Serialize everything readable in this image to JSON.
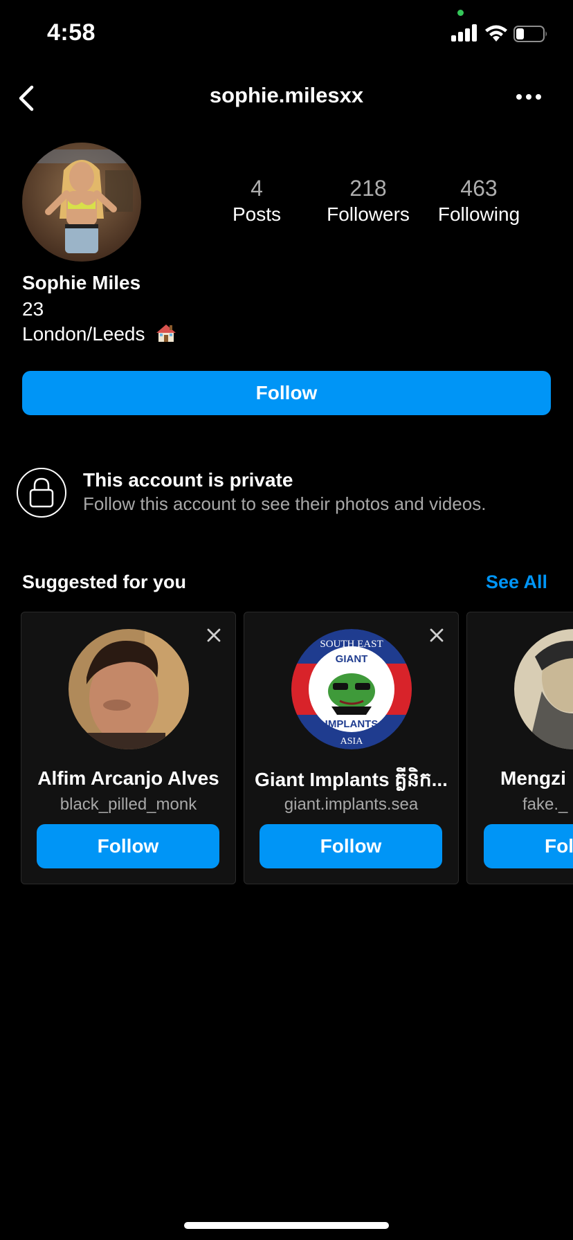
{
  "status_bar": {
    "time": "4:58"
  },
  "header": {
    "username": "sophie.milesxx"
  },
  "profile": {
    "stats": [
      {
        "value": "4",
        "label": "Posts"
      },
      {
        "value": "218",
        "label": "Followers"
      },
      {
        "value": "463",
        "label": "Following"
      }
    ],
    "full_name": "Sophie Miles",
    "bio_line1": "23",
    "bio_line2": "London/Leeds",
    "bio_emoji_icon": "house-emoji-icon",
    "follow_label": "Follow"
  },
  "private_notice": {
    "title": "This account is private",
    "subtitle": "Follow this account to see their photos and videos."
  },
  "suggested": {
    "title": "Suggested for you",
    "see_all": "See All",
    "cards": [
      {
        "name": "Alfim Arcanjo Alves",
        "handle": "black_pilled_monk",
        "follow_label": "Follow"
      },
      {
        "name": "Giant Implants គ្លីនិក...",
        "handle": "giant.implants.sea",
        "follow_label": "Follow",
        "avatar_text_top": "SOUTH EAST",
        "avatar_text_mid": "GIANT",
        "avatar_text_bottom": "IMPLANTS",
        "avatar_text_foot": "ASIA"
      },
      {
        "name": "Mengzi",
        "handle": "fake._",
        "follow_label": "Follow"
      }
    ]
  },
  "colors": {
    "accent": "#0095f6",
    "background": "#000000",
    "card": "#121212",
    "muted": "#a8a8a8"
  }
}
